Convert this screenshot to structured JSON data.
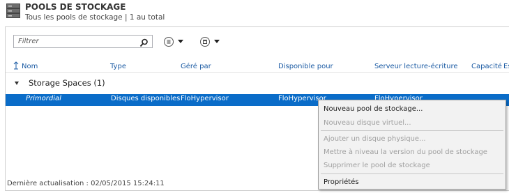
{
  "header": {
    "title": "POOLS DE STOCKAGE",
    "subtitle": "Tous les pools de stockage | 1 au total"
  },
  "toolbar": {
    "filter_placeholder": "Filtrer",
    "search_icon": "search-icon",
    "view_icon": "list-view-icon",
    "group_icon": "save-view-icon"
  },
  "table": {
    "columns": [
      "Nom",
      "Type",
      "Géré par",
      "Disponible pour",
      "Serveur lecture-écriture",
      "Capacité",
      "Es"
    ],
    "group": {
      "label": "Storage Spaces (1)"
    },
    "rows": [
      {
        "name": "Primordial",
        "type": "Disques disponibles",
        "managed_by": "FloHypervisor",
        "available_for": "FloHypervisor",
        "rw_server": "FloHypervisor"
      }
    ]
  },
  "status_bar": {
    "text": "Dernière actualisation : 02/05/2015 15:24:11"
  },
  "context_menu": {
    "items": [
      {
        "label": "Nouveau pool de stockage...",
        "enabled": true
      },
      {
        "label": "Nouveau disque virtuel...",
        "enabled": false
      },
      {
        "label": "Ajouter un disque physique...",
        "enabled": false
      },
      {
        "label": "Mettre à niveau la version du pool de stockage",
        "enabled": false
      },
      {
        "label": "Supprimer le pool de stockage",
        "enabled": false
      },
      {
        "label": "Propriétés",
        "enabled": true
      }
    ]
  },
  "colors": {
    "selection": "#0a6cc8",
    "header_link": "#1a5aa3"
  }
}
